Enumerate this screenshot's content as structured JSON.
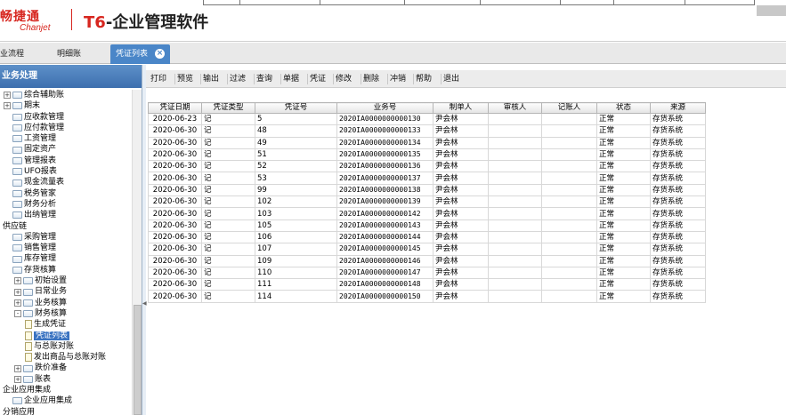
{
  "header": {
    "logo_cn": "畅捷通",
    "logo_en": "Chanjet",
    "title_prefix": "T6",
    "title_rest": "-企业管理软件"
  },
  "tabs": [
    {
      "label": "业流程"
    },
    {
      "label": "明细账"
    },
    {
      "label": "凭证列表",
      "active": true,
      "close_icon": "close-icon"
    }
  ],
  "sidebar": {
    "title": "业务处理",
    "tree": [
      {
        "label": "综合辅助账",
        "level": 0,
        "exp": "+",
        "icon": "folder"
      },
      {
        "label": "期末",
        "level": 0,
        "exp": "+",
        "icon": "folder"
      },
      {
        "label": "应收款管理",
        "level": 0,
        "exp": "",
        "icon": "folder"
      },
      {
        "label": "应付款管理",
        "level": 0,
        "exp": "",
        "icon": "folder"
      },
      {
        "label": "工资管理",
        "level": 0,
        "exp": "",
        "icon": "folder"
      },
      {
        "label": "固定资产",
        "level": 0,
        "exp": "",
        "icon": "folder"
      },
      {
        "label": "管理报表",
        "level": 0,
        "exp": "",
        "icon": "folder"
      },
      {
        "label": "UFO报表",
        "level": 0,
        "exp": "",
        "icon": "folder"
      },
      {
        "label": "现金流量表",
        "level": 0,
        "exp": "",
        "icon": "folder"
      },
      {
        "label": "税务管家",
        "level": 0,
        "exp": "",
        "icon": "folder"
      },
      {
        "label": "财务分析",
        "level": 0,
        "exp": "",
        "icon": "folder"
      },
      {
        "label": "出纳管理",
        "level": 0,
        "exp": "",
        "icon": "folder"
      },
      {
        "label": "供应链",
        "level": -1,
        "exp": "",
        "icon": "none"
      },
      {
        "label": "采购管理",
        "level": 0,
        "exp": "",
        "icon": "folder"
      },
      {
        "label": "销售管理",
        "level": 0,
        "exp": "",
        "icon": "folder"
      },
      {
        "label": "库存管理",
        "level": 0,
        "exp": "",
        "icon": "folder"
      },
      {
        "label": "存货核算",
        "level": 0,
        "exp": "",
        "icon": "folder"
      },
      {
        "label": "初始设置",
        "level": 1,
        "exp": "+",
        "icon": "folder"
      },
      {
        "label": "日常业务",
        "level": 1,
        "exp": "+",
        "icon": "folder"
      },
      {
        "label": "业务核算",
        "level": 1,
        "exp": "+",
        "icon": "folder"
      },
      {
        "label": "财务核算",
        "level": 1,
        "exp": "-",
        "icon": "folder"
      },
      {
        "label": "生成凭证",
        "level": 2,
        "exp": "",
        "icon": "page"
      },
      {
        "label": "凭证列表",
        "level": 2,
        "exp": "",
        "icon": "page",
        "selected": true
      },
      {
        "label": "与总账对账",
        "level": 2,
        "exp": "",
        "icon": "page"
      },
      {
        "label": "发出商品与总账对账",
        "level": 2,
        "exp": "",
        "icon": "page"
      },
      {
        "label": "跌价准备",
        "level": 1,
        "exp": "+",
        "icon": "folder"
      },
      {
        "label": "账表",
        "level": 1,
        "exp": "+",
        "icon": "folder"
      },
      {
        "label": "企业应用集成",
        "level": -1,
        "exp": "",
        "icon": "none"
      },
      {
        "label": "企业应用集成",
        "level": 0,
        "exp": "",
        "icon": "folder"
      },
      {
        "label": "分销应用",
        "level": -1,
        "exp": "",
        "icon": "none"
      }
    ]
  },
  "toolbar": [
    "打印",
    "预览",
    "输出",
    "过滤",
    "查询",
    "单据",
    "凭证",
    "修改",
    "删除",
    "冲销",
    "帮助",
    "退出"
  ],
  "table": {
    "columns": [
      "凭证日期",
      "凭证类型",
      "凭证号",
      "业务号",
      "制单人",
      "审核人",
      "记账人",
      "状态",
      "来源"
    ],
    "rows": [
      [
        "2020-06-23",
        "记",
        "5",
        "2020IA0000000000130",
        "尹会林",
        "",
        "",
        "正常",
        "存货系统"
      ],
      [
        "2020-06-30",
        "记",
        "48",
        "2020IA0000000000133",
        "尹会林",
        "",
        "",
        "正常",
        "存货系统"
      ],
      [
        "2020-06-30",
        "记",
        "49",
        "2020IA0000000000134",
        "尹会林",
        "",
        "",
        "正常",
        "存货系统"
      ],
      [
        "2020-06-30",
        "记",
        "51",
        "2020IA0000000000135",
        "尹会林",
        "",
        "",
        "正常",
        "存货系统"
      ],
      [
        "2020-06-30",
        "记",
        "52",
        "2020IA0000000000136",
        "尹会林",
        "",
        "",
        "正常",
        "存货系统"
      ],
      [
        "2020-06-30",
        "记",
        "53",
        "2020IA0000000000137",
        "尹会林",
        "",
        "",
        "正常",
        "存货系统"
      ],
      [
        "2020-06-30",
        "记",
        "99",
        "2020IA0000000000138",
        "尹会林",
        "",
        "",
        "正常",
        "存货系统"
      ],
      [
        "2020-06-30",
        "记",
        "102",
        "2020IA0000000000139",
        "尹会林",
        "",
        "",
        "正常",
        "存货系统"
      ],
      [
        "2020-06-30",
        "记",
        "103",
        "2020IA0000000000142",
        "尹会林",
        "",
        "",
        "正常",
        "存货系统"
      ],
      [
        "2020-06-30",
        "记",
        "105",
        "2020IA0000000000143",
        "尹会林",
        "",
        "",
        "正常",
        "存货系统"
      ],
      [
        "2020-06-30",
        "记",
        "106",
        "2020IA0000000000144",
        "尹会林",
        "",
        "",
        "正常",
        "存货系统"
      ],
      [
        "2020-06-30",
        "记",
        "107",
        "2020IA0000000000145",
        "尹会林",
        "",
        "",
        "正常",
        "存货系统"
      ],
      [
        "2020-06-30",
        "记",
        "109",
        "2020IA0000000000146",
        "尹会林",
        "",
        "",
        "正常",
        "存货系统"
      ],
      [
        "2020-06-30",
        "记",
        "110",
        "2020IA0000000000147",
        "尹会林",
        "",
        "",
        "正常",
        "存货系统"
      ],
      [
        "2020-06-30",
        "记",
        "111",
        "2020IA0000000000148",
        "尹会林",
        "",
        "",
        "正常",
        "存货系统"
      ],
      [
        "2020-06-30",
        "记",
        "114",
        "2020IA0000000000150",
        "尹会林",
        "",
        "",
        "正常",
        "存货系统"
      ]
    ]
  },
  "colors": {
    "brand_red": "#d7261f",
    "tab_active": "#4a86c8",
    "sidebar_header": "#4a7fbd",
    "selection": "#3a73c1"
  }
}
